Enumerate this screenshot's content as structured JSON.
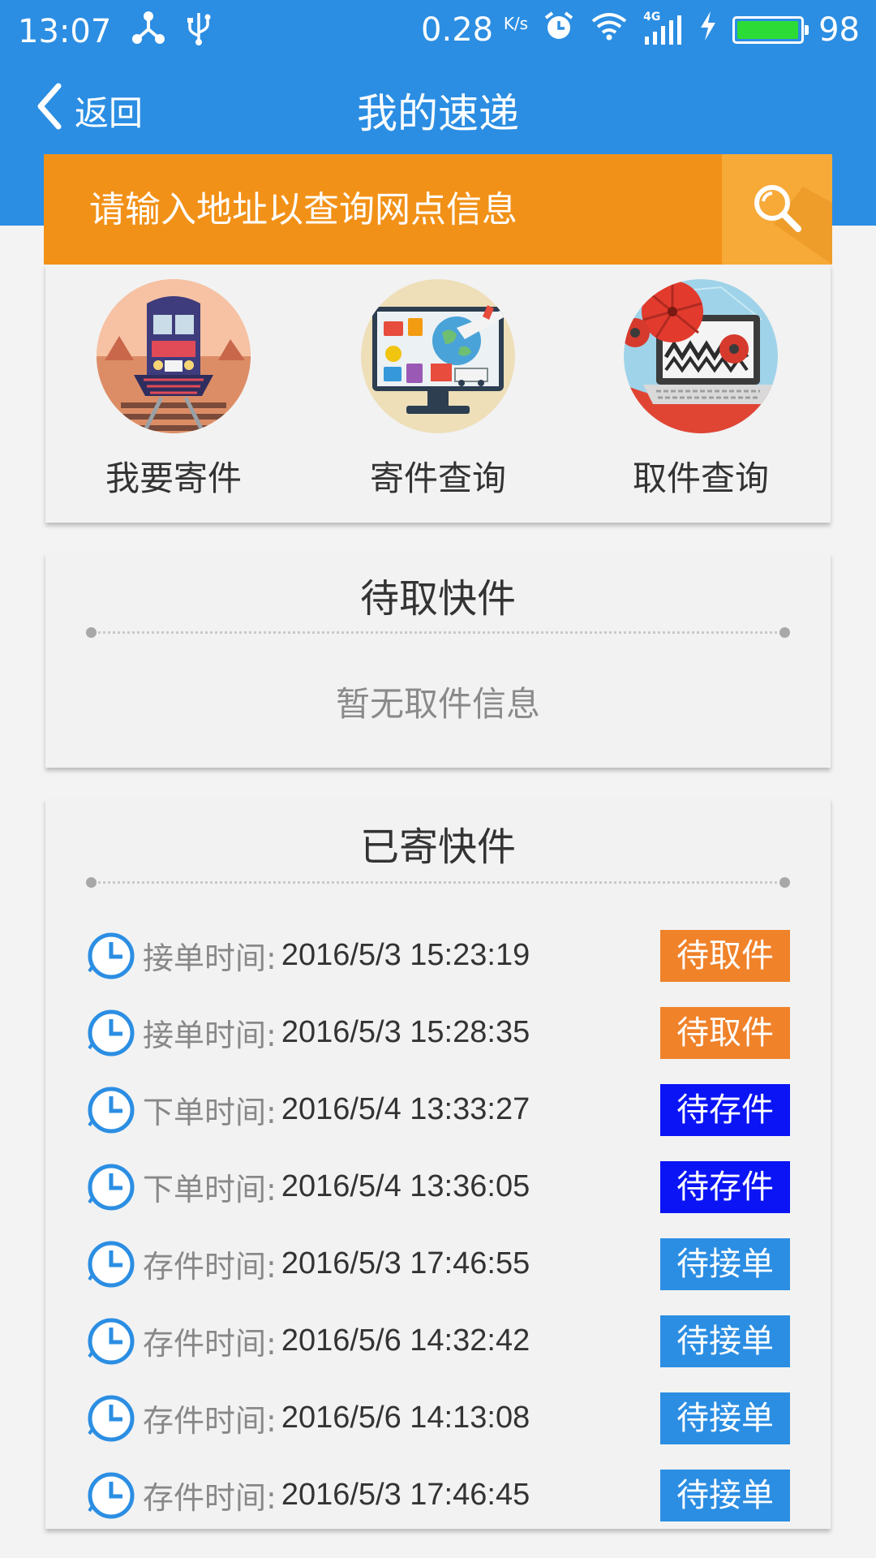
{
  "status_bar": {
    "time": "13:07",
    "speed": "0.28",
    "speed_unit": "K/s",
    "network": "4G",
    "battery": "98",
    "battery_level": 0.98
  },
  "header": {
    "back_label": "返回",
    "title": "我的速递"
  },
  "search": {
    "placeholder": "请输入地址以查询网点信息"
  },
  "actions": [
    {
      "label": "我要寄件",
      "icon": "train-icon"
    },
    {
      "label": "寄件查询",
      "icon": "shipping-monitor-icon"
    },
    {
      "label": "取件查询",
      "icon": "laptop-icon"
    }
  ],
  "pending": {
    "title": "待取快件",
    "empty_text": "暂无取件信息"
  },
  "sent": {
    "title": "已寄快件",
    "items": [
      {
        "label": "接单时间:",
        "time": "2016/5/3 15:23:19",
        "status": "待取件",
        "status_color": "#f0822a"
      },
      {
        "label": "接单时间:",
        "time": "2016/5/3 15:28:35",
        "status": "待取件",
        "status_color": "#f0822a"
      },
      {
        "label": "下单时间:",
        "time": "2016/5/4 13:33:27",
        "status": "待存件",
        "status_color": "#0a14f5"
      },
      {
        "label": "下单时间:",
        "time": "2016/5/4 13:36:05",
        "status": "待存件",
        "status_color": "#0a14f5"
      },
      {
        "label": "存件时间:",
        "time": "2016/5/3 17:46:55",
        "status": "待接单",
        "status_color": "#2b8ee3"
      },
      {
        "label": "存件时间:",
        "time": "2016/5/6 14:32:42",
        "status": "待接单",
        "status_color": "#2b8ee3"
      },
      {
        "label": "存件时间:",
        "time": "2016/5/6 14:13:08",
        "status": "待接单",
        "status_color": "#2b8ee3"
      },
      {
        "label": "存件时间:",
        "time": "2016/5/3 17:46:45",
        "status": "待接单",
        "status_color": "#2b8ee3"
      }
    ]
  },
  "colors": {
    "primary": "#2b8ee3",
    "search_bg": "#f29117",
    "search_button": "#f7aa38",
    "page_bg": "#f3f3f3"
  }
}
